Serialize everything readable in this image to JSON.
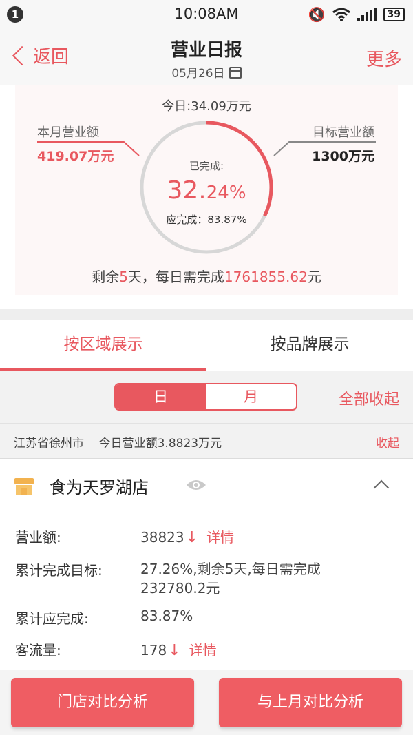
{
  "status_bar": {
    "notification_count": "1",
    "time": "10:08AM",
    "battery": "39"
  },
  "nav": {
    "back_label": "返回",
    "title": "营业日报",
    "date": "05月26日",
    "more_label": "更多"
  },
  "summary": {
    "today": "今日:34.09万元",
    "month_label": "本月营业额",
    "month_value": "419.07万元",
    "target_label": "目标营业额",
    "target_value": "1300万元",
    "completed_label": "已完成:",
    "completed_percent_int": "32.",
    "completed_percent_frac": "24%",
    "completed_fraction": 0.3224,
    "should_complete": "应完成：83.87%",
    "remain_prefix": "剩余",
    "remain_days": "5",
    "remain_mid": "天，每日需完成",
    "remain_amount": "1761855.62",
    "remain_suffix": "元"
  },
  "tabs": [
    {
      "label": "按区域展示",
      "active": true
    },
    {
      "label": "按品牌展示",
      "active": false
    }
  ],
  "filter": {
    "day_label": "日",
    "month_label": "月",
    "collapse_all": "全部收起"
  },
  "region": {
    "text": "江苏省徐州市    今日营业额3.8823万元",
    "collapse": "收起"
  },
  "store": {
    "name": "食为天罗湖店",
    "rows": [
      {
        "label": "营业额:",
        "value": "38823",
        "arrow": "↓",
        "link": "详情"
      },
      {
        "label": "累计完成目标:",
        "value_line1": "27.26%,剩余5天,每日需完成",
        "value_line2": "232780.2元"
      },
      {
        "label": "累计应完成:",
        "value": "83.87%"
      },
      {
        "label": "客流量:",
        "value": "178",
        "arrow": "↓",
        "link": "详情"
      }
    ]
  },
  "buttons": {
    "compare_stores": "门店对比分析",
    "compare_last_month": "与上月对比分析"
  },
  "colors": {
    "accent": "#e8585f",
    "gauge_track": "#d7d7d7"
  }
}
